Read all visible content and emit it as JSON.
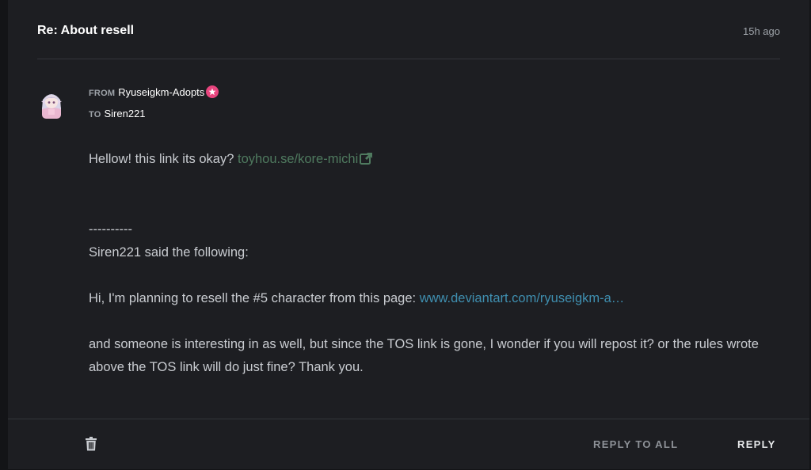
{
  "message": {
    "subject": "Re: About resell",
    "time": "15h ago",
    "from_label": "FROM",
    "from_name": "Ryuseigkm-Adopts",
    "to_label": "TO",
    "to_name": "Siren221",
    "body": {
      "line1_text": "Hellow! this link its okay? ",
      "line1_link": "toyhou.se/kore-michi",
      "separator": "----------",
      "said": "Siren221 said the following:",
      "quote1_text": "Hi, I'm planning to resell the #5 character from this page: ",
      "quote1_link": "www.deviantart.com/ryuseigkm-a…",
      "quote2": "and someone is interesting in as well, but since the TOS link is gone, I wonder if you will repost it? or the rules wrote above the TOS link will do just fine? Thank you."
    }
  },
  "actions": {
    "reply_all": "REPLY TO ALL",
    "reply": "REPLY"
  },
  "icons": {
    "sender_badge": "star-badge-icon",
    "external_link": "external-link-icon",
    "delete": "trash-icon"
  },
  "colors": {
    "link_green": "#4f7a5f",
    "link_blue": "#3f8fb0",
    "badge": "#e8457e"
  }
}
